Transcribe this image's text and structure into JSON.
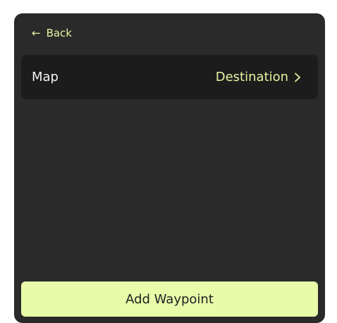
{
  "header": {
    "back_arrow": "←",
    "back_label": "Back"
  },
  "settings_row": {
    "label": "Map",
    "value": "Destination",
    "chevron_icon": "chevron-right-icon"
  },
  "footer": {
    "add_waypoint_label": "Add Waypoint"
  },
  "colors": {
    "panel_background": "#2a2a2a",
    "row_background": "#1c1c1c",
    "accent": "#e4f5a3",
    "button_background": "#e7fba9"
  }
}
